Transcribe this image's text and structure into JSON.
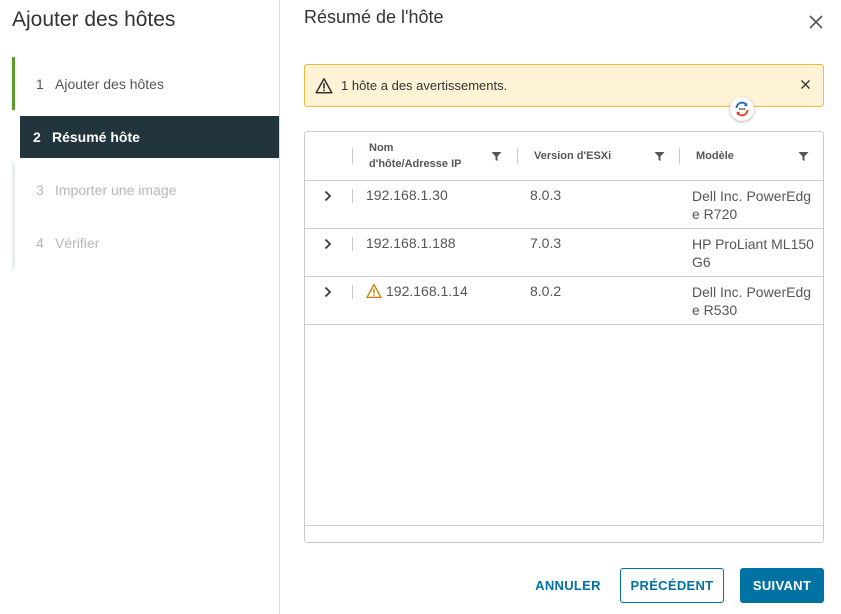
{
  "wizard": {
    "title": "Ajouter des hôtes",
    "steps": [
      {
        "number": "1",
        "label": "Ajouter des hôtes",
        "state": "done"
      },
      {
        "number": "2",
        "label": "Résumé hôte",
        "state": "active"
      },
      {
        "number": "3",
        "label": "Importer une image",
        "state": "disabled"
      },
      {
        "number": "4",
        "label": "Vérifier",
        "state": "disabled"
      }
    ]
  },
  "page": {
    "title": "Résumé de l'hôte",
    "close_icon": "close-icon"
  },
  "alert": {
    "text": "1 hôte a des avertissements.",
    "icon": "warning-triangle-icon",
    "color_bg": "#fef3d5",
    "color_border": "#f0b93a"
  },
  "grid": {
    "columns": [
      {
        "label": "Nom d'hôte/Adresse IP"
      },
      {
        "label": "Version d'ESXi"
      },
      {
        "label": "Modèle"
      }
    ],
    "rows": [
      {
        "name": "192.168.1.30",
        "version": "8.0.3",
        "model": "Dell Inc. PowerEdge R720",
        "warning": false
      },
      {
        "name": "192.168.1.188",
        "version": "7.0.3",
        "model": "HP ProLiant ML150 G6",
        "warning": true
      },
      {
        "name": "192.168.1.14",
        "version": "8.0.2",
        "model": "Dell Inc. PowerEdge R530",
        "warning": true
      }
    ]
  },
  "buttons": {
    "cancel": "ANNULER",
    "previous": "PRÉCÉDENT",
    "next": "SUIVANT"
  },
  "colors": {
    "primary": "#0072a3",
    "active_step_bg": "#22343c",
    "done_step": "#5a9b2a"
  }
}
